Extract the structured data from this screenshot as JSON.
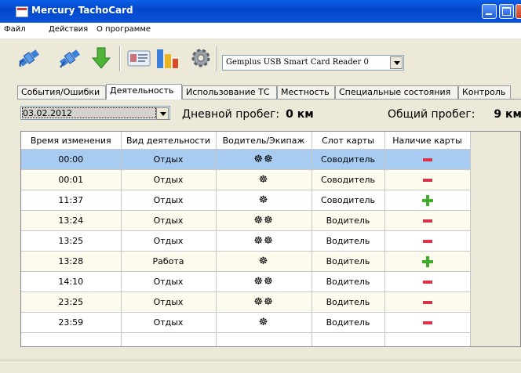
{
  "window": {
    "title": "Mercury TachoCard"
  },
  "menu": [
    "Файл",
    "Действия",
    "О программе"
  ],
  "toolbar": {
    "icons": [
      "satellite-connect-icon",
      "satellite-disconnect-icon",
      "download-arrow-icon",
      "card-view-icon",
      "bar-chart-icon",
      "settings-gear-icon"
    ],
    "reader": "Gemplus USB Smart Card Reader 0"
  },
  "tabs": [
    "События/Ошибки",
    "Деятельность",
    "Использование ТС",
    "Местность",
    "Специальные состояния",
    "Контроль"
  ],
  "active_tab": "Деятельность",
  "filter": {
    "date": "03.02.2012",
    "daily_label": "Дневной пробег:",
    "daily_value": "0 км",
    "total_label": "Общий пробег:",
    "total_value": "9 км"
  },
  "table": {
    "columns": [
      "Время изменения",
      "Вид деятельности",
      "Водитель/Экипаж",
      "Слот карты",
      "Наличие карты"
    ],
    "rows": [
      {
        "time": "00:00",
        "activity": "Отдых",
        "crew": "☸☸",
        "slot": "Соводитель",
        "card": "minus"
      },
      {
        "time": "00:01",
        "activity": "Отдых",
        "crew": "☸",
        "slot": "Соводитель",
        "card": "minus"
      },
      {
        "time": "11:37",
        "activity": "Отдых",
        "crew": "☸",
        "slot": "Соводитель",
        "card": "plus"
      },
      {
        "time": "13:24",
        "activity": "Отдых",
        "crew": "☸☸",
        "slot": "Водитель",
        "card": "minus"
      },
      {
        "time": "13:25",
        "activity": "Отдых",
        "crew": "☸☸",
        "slot": "Водитель",
        "card": "minus"
      },
      {
        "time": "13:28",
        "activity": "Работа",
        "crew": "☸",
        "slot": "Водитель",
        "card": "plus"
      },
      {
        "time": "14:10",
        "activity": "Отдых",
        "crew": "☸☸",
        "slot": "Водитель",
        "card": "minus"
      },
      {
        "time": "23:25",
        "activity": "Отдых",
        "crew": "☸☸",
        "slot": "Водитель",
        "card": "minus"
      },
      {
        "time": "23:59",
        "activity": "Отдых",
        "crew": "☸",
        "slot": "Водитель",
        "card": "minus"
      }
    ]
  },
  "colors": {
    "selected_row": "#a8cbf2",
    "minus": "#d9324a",
    "plus": "#3fad2a",
    "title_bar": "#0a5fe8"
  }
}
